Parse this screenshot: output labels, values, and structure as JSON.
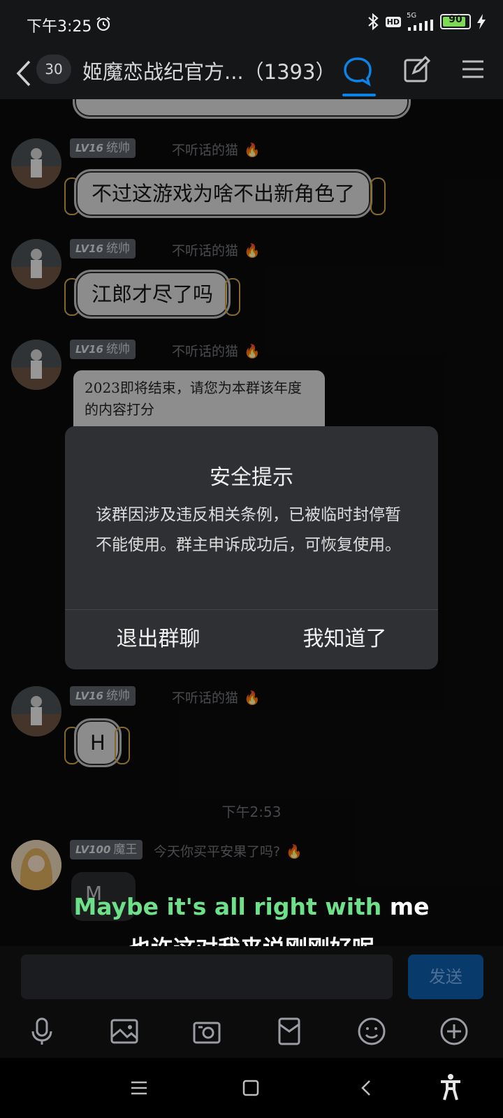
{
  "status": {
    "time": "下午3:25",
    "network": "5G",
    "hd": "HD",
    "battery_level": "90",
    "icons": [
      "alarm-icon",
      "bluetooth-icon",
      "signal-icon",
      "battery-icon",
      "charging-icon"
    ]
  },
  "header": {
    "unread_count": "30",
    "title": "姬魔恋战纪官方...（1393）",
    "icons": [
      "back-icon",
      "chat-bubble-icon",
      "edit-icon",
      "menu-icon"
    ]
  },
  "messages": [
    {
      "level": "LV16",
      "rank": "统帅",
      "name": "不听话的猫",
      "text": "不过这游戏为啥不出新角色了"
    },
    {
      "level": "LV16",
      "rank": "统帅",
      "name": "不听话的猫",
      "text": "江郎才尽了吗"
    },
    {
      "level": "LV16",
      "rank": "统帅",
      "name": "不听话的猫",
      "text": "2023即将结束，请您为本群该年度的内容打分"
    },
    {
      "level": "LV16",
      "rank": "统帅",
      "name": "不听话的猫",
      "text": "H"
    }
  ],
  "time_divider": "下午2:53",
  "last_message": {
    "level": "LV100",
    "rank": "魔王",
    "name": "今天你买平安果了吗?",
    "text": "M"
  },
  "dialog": {
    "title": "安全提示",
    "body": "该群因涉及违反相关条例，已被临时封停暂不能使用。群主申诉成功后，可恢复使用。",
    "exit_label": "退出群聊",
    "ok_label": "我知道了"
  },
  "subtitle": {
    "en_highlight": "Maybe it's all right with",
    "en_rest": " me",
    "zh": "也许这对我来说刚刚好呢"
  },
  "composer": {
    "input_value": "",
    "send_label": "发送"
  },
  "toolbar_icons": [
    "microphone-icon",
    "image-icon",
    "camera-icon",
    "red-packet-icon",
    "emoji-icon",
    "plus-icon"
  ],
  "nav_icons": [
    "recents-icon",
    "home-icon",
    "back-nav-icon",
    "accessibility-icon"
  ],
  "colors": {
    "accent": "#0a84e8",
    "fire": "#ff6a1a",
    "subtitle_highlight": "#6ee08a"
  }
}
